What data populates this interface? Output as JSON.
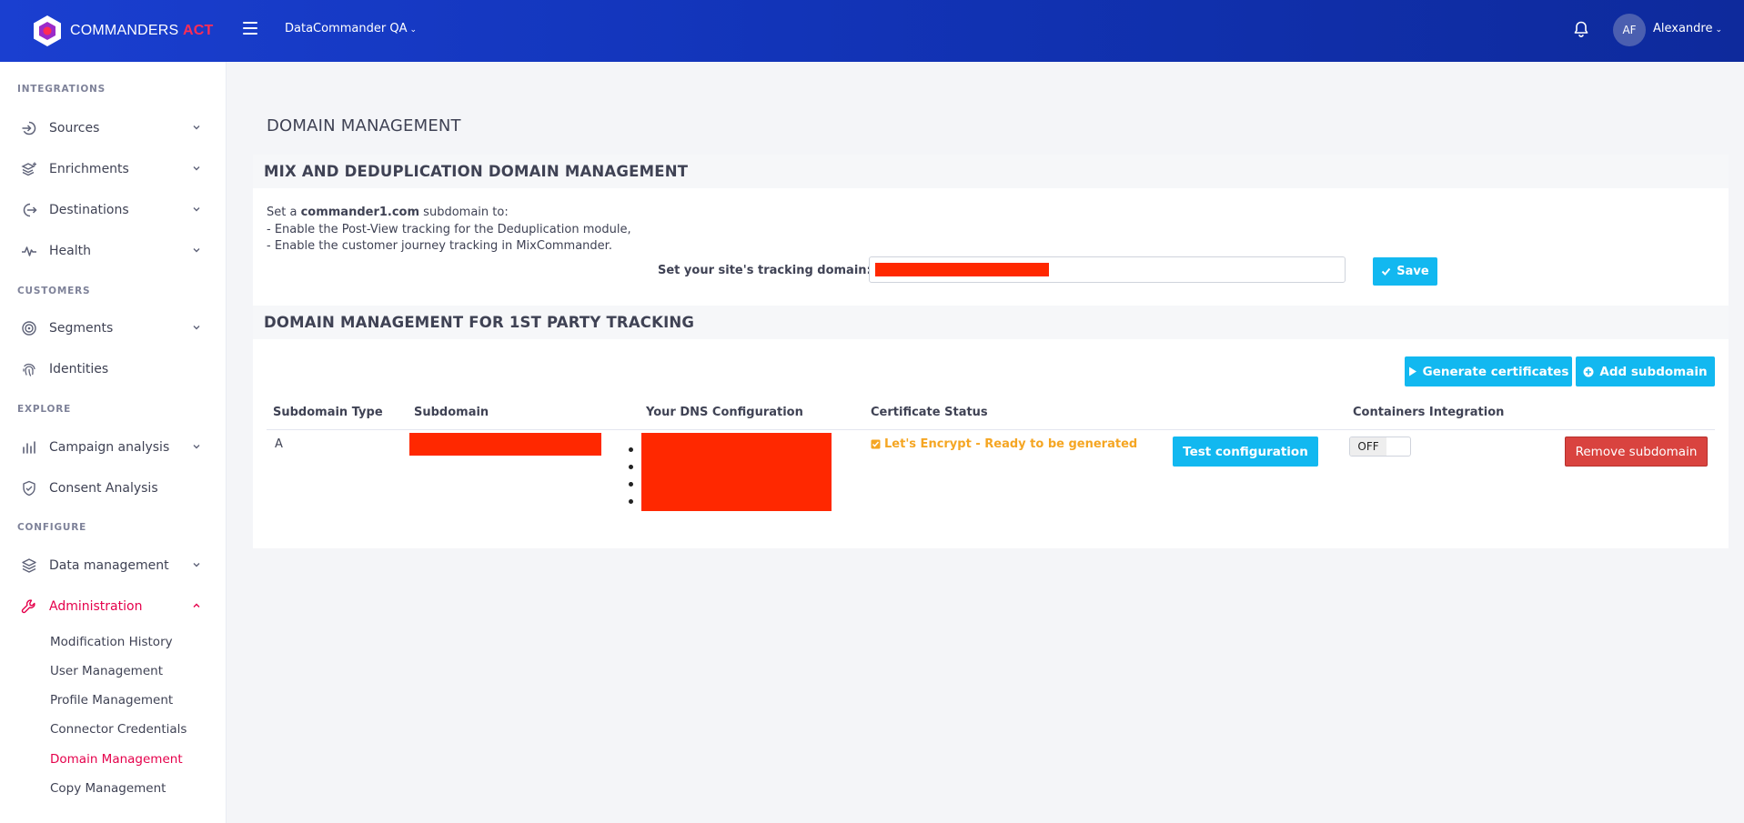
{
  "app": {
    "brand_main": "COMMANDERS",
    "brand_accent": "ACT",
    "workspace": "DataCommander QA",
    "user_initials": "AF",
    "user_name": "Alexandre"
  },
  "sidebar": {
    "sections": {
      "integrations": "INTEGRATIONS",
      "customers": "CUSTOMERS",
      "explore": "EXPLORE",
      "configure": "CONFIGURE"
    },
    "items": {
      "sources": "Sources",
      "enrichments": "Enrichments",
      "destinations": "Destinations",
      "health": "Health",
      "segments": "Segments",
      "identities": "Identities",
      "campaign_analysis": "Campaign analysis",
      "consent_analysis": "Consent Analysis",
      "data_management": "Data management",
      "administration": "Administration"
    },
    "admin_sub": {
      "modification_history": "Modification History",
      "user_management": "User Management",
      "profile_management": "Profile Management",
      "connector_credentials": "Connector Credentials",
      "domain_management": "Domain Management",
      "copy_management": "Copy Management"
    }
  },
  "main": {
    "page_title": "DOMAIN MANAGEMENT",
    "mix": {
      "title": "MIX AND DEDUPLICATION DOMAIN MANAGEMENT",
      "desc_prefix": "Set a ",
      "desc_domain": "commander1.com",
      "desc_suffix": " subdomain to:",
      "desc_line2": "- Enable the Post-View tracking for the Deduplication module,",
      "desc_line3": "- Enable the customer journey tracking in MixCommander.",
      "field_label": "Set your site's tracking domain:",
      "save_label": "Save"
    },
    "first_party": {
      "title": "DOMAIN MANAGEMENT FOR 1ST PARTY TRACKING",
      "generate_label": "Generate certificates",
      "add_label": "Add subdomain",
      "columns": [
        "Subdomain Type",
        "Subdomain",
        "Your DNS Configuration",
        "Certificate Status",
        "",
        "Containers Integration",
        ""
      ],
      "row": {
        "type": "A",
        "cert_status": "Let's Encrypt - Ready to be generated",
        "test_label": "Test configuration",
        "toggle_state": "OFF",
        "remove_label": "Remove subdomain"
      }
    }
  },
  "colors": {
    "accent": "#e5004b",
    "button": "#12b8f0",
    "danger": "#d9433f",
    "warning": "#f5a623",
    "redaction": "#ff2800"
  }
}
